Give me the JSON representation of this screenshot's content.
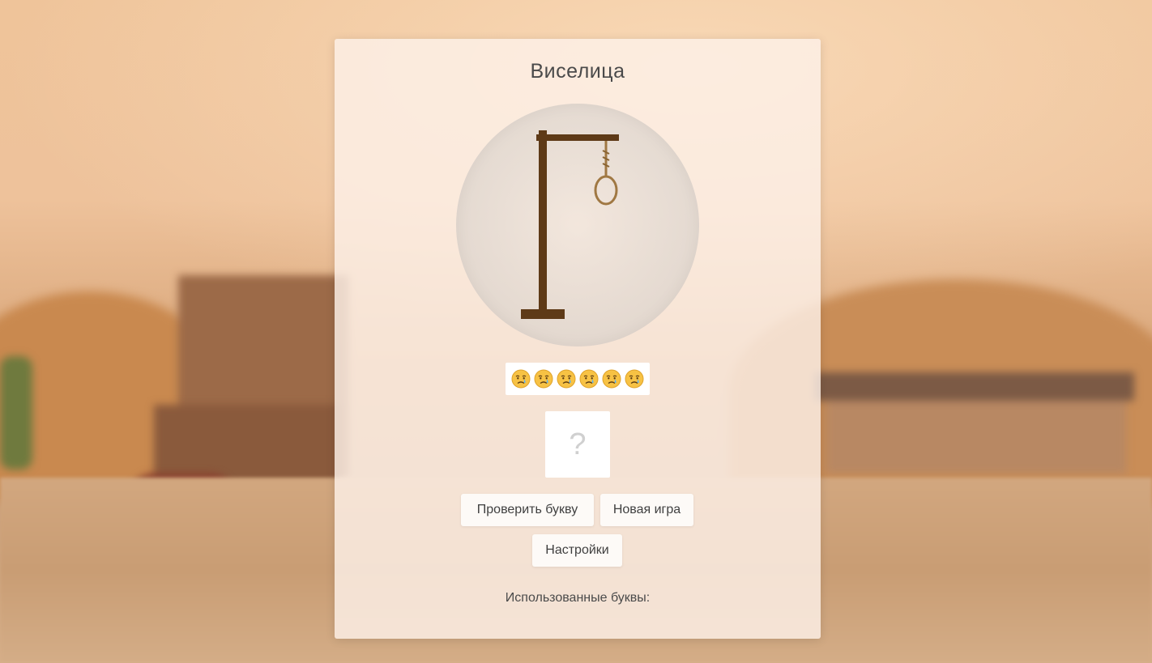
{
  "game": {
    "title": "Виселица",
    "lives_total": 6,
    "lives_remaining": 6,
    "life_icon": "sad-face-icon",
    "hidden_letter": "?",
    "used_letters_label": "Использованные буквы:",
    "used_letters": ""
  },
  "buttons": {
    "check_letter": "Проверить букву",
    "new_game": "Новая игра",
    "settings": "Настройки"
  },
  "colors": {
    "wood": "#5e3a17",
    "rope": "#a07843",
    "card_bg": "#fcf0e8"
  }
}
